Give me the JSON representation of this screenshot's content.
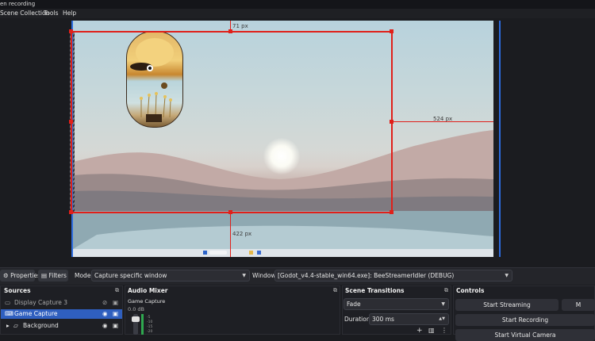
{
  "window": {
    "title": "en recording"
  },
  "menu": {
    "items": [
      "Scene Collection",
      "Tools",
      "Help"
    ]
  },
  "preview": {
    "top_measure": "71 px",
    "right_measure": "524 px",
    "bottom_measure": "422 px"
  },
  "toolbar": {
    "properties_label": "Properties",
    "filters_label": "Filters",
    "mode_label": "Mode",
    "mode_value": "Capture specific window",
    "window_label": "Window",
    "window_value": "[Godot_v4.4-stable_win64.exe]: BeeStreamerIdler (DEBUG)"
  },
  "sources": {
    "title": "Sources",
    "items": [
      {
        "name": "Display Capture 3",
        "selected": false
      },
      {
        "name": "Game Capture",
        "selected": true
      },
      {
        "name": "Background",
        "selected": false
      }
    ]
  },
  "audio_mixer": {
    "title": "Audio Mixer",
    "channel": "Game Capture",
    "level": "0.0 dB",
    "ticks": [
      "-5",
      "-10",
      "-15",
      "-20"
    ]
  },
  "scene_transitions": {
    "title": "Scene Transitions",
    "transition": "Fade",
    "duration_label": "Duration",
    "duration_value": "300 ms"
  },
  "controls": {
    "title": "Controls",
    "start_streaming": "Start Streaming",
    "start_recording": "Start Recording",
    "start_virtual_camera": "Start Virtual Camera",
    "studio_mode_partial": "M"
  },
  "colors": {
    "accent": "#2d6cdf",
    "selection": "#e0201a",
    "selected_row": "#2f5fbf"
  }
}
